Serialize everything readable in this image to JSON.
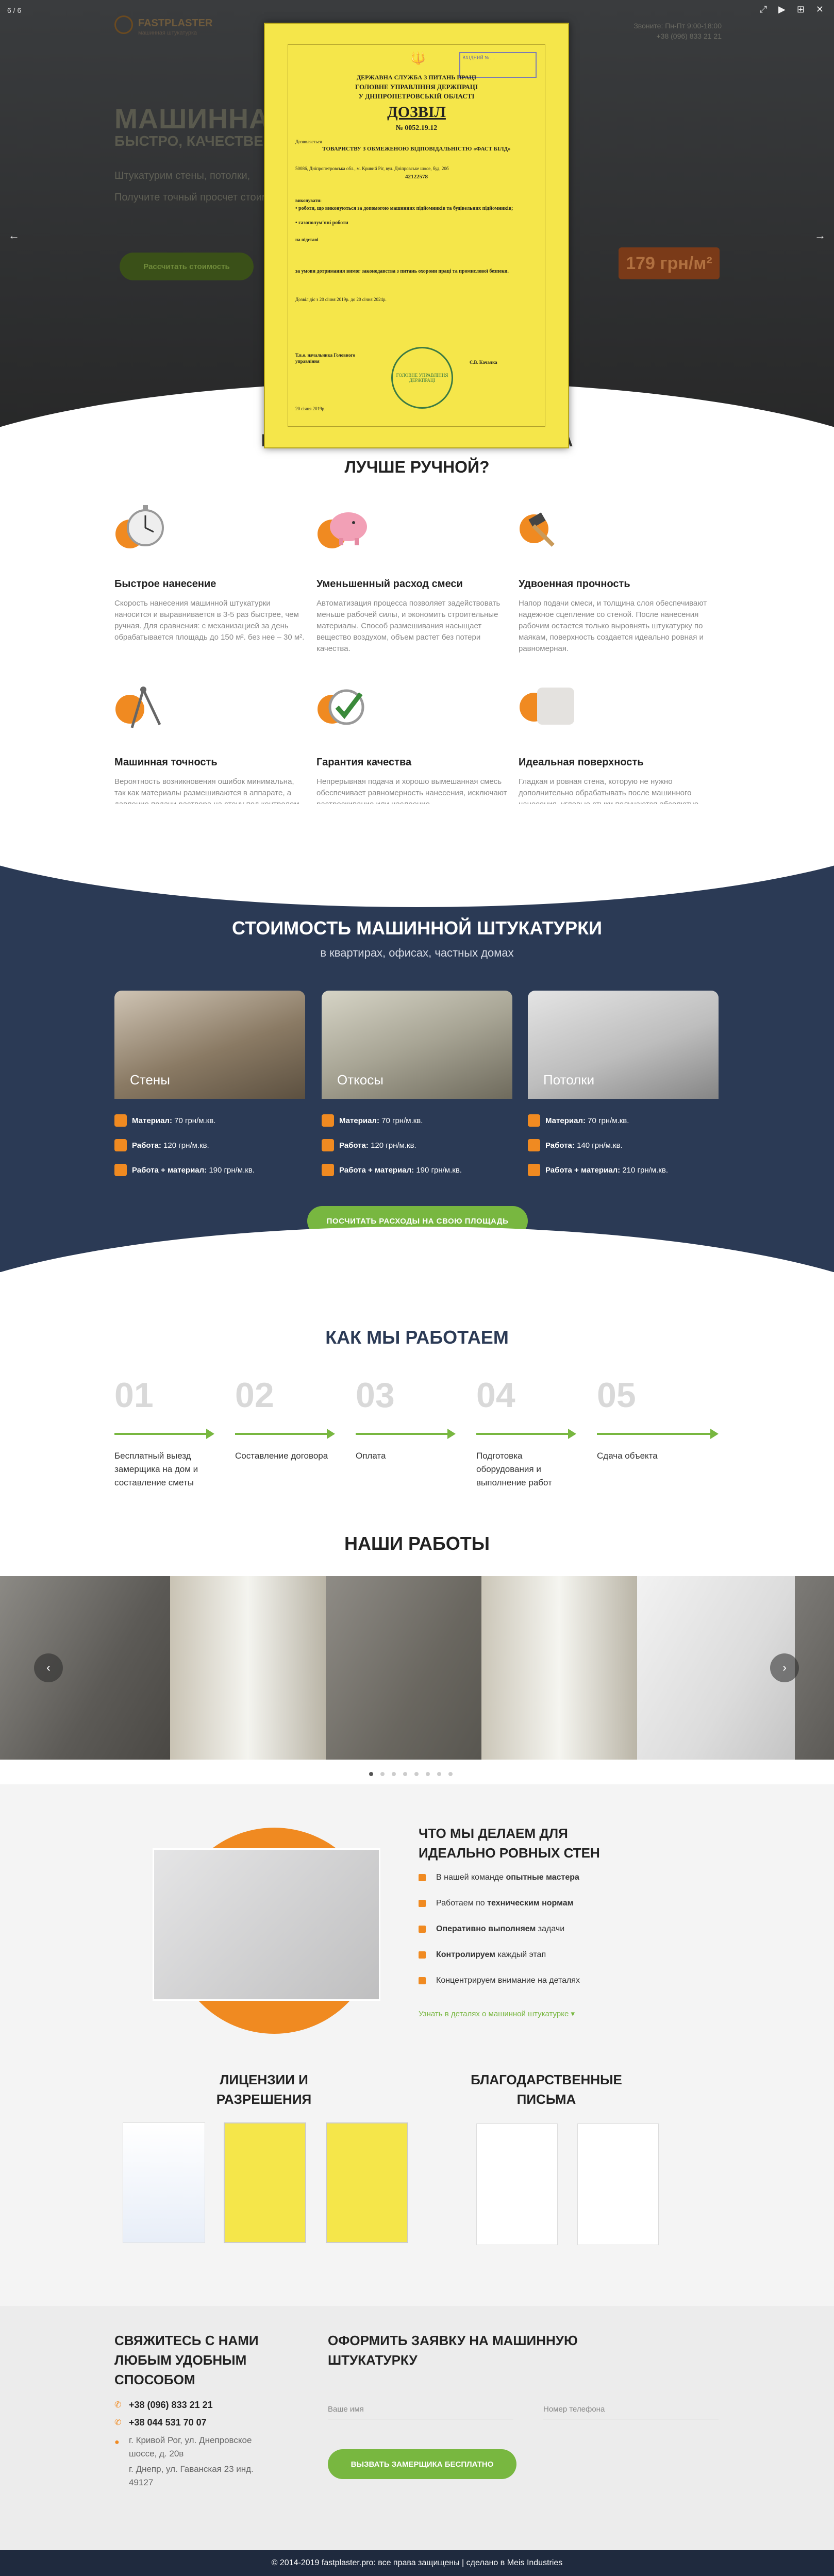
{
  "lightbox": {
    "counter": "6 / 6",
    "prev": "←",
    "next": "→",
    "tools": [
      "⤢",
      "▶",
      "⊞",
      "✕"
    ]
  },
  "hero": {
    "logo_title": "FASTPLASTER",
    "logo_sub": "машинная штукатурка",
    "contact_line1": "Звоните: Пн-Пт 9:00-18:00",
    "contact_line2": "+38 (096) 833 21 21",
    "h1": "МАШИННАЯ",
    "h2": "БЫСТРО, КАЧЕСТВЕННО",
    "p1": "Штукатурим стены, потолки,",
    "p2": "Получите точный просчет стоимости",
    "btn": "Рассчитать стоимость",
    "price": "179 грн/м²",
    "ghost_heading": "ПОЧЕМУ МАШИННАЯ ШТУКАТУРКА"
  },
  "license": {
    "stamp": "ВХІДНИЙ № ....",
    "l1": "ДЕРЖАВНА СЛУЖБА З ПИТАНЬ ПРАЦІ",
    "l2": "ГОЛОВНЕ УПРАВЛІННЯ ДЕРЖПРАЦІ",
    "l3": "У ДНІПРОПЕТРОВСЬКІЙ ОБЛАСТІ",
    "doc": "ДОЗВІЛ",
    "num": "№ 0052.19.12",
    "allowed": "Дозволяється",
    "company": "ТОВАРИСТВУ З ОБМЕЖЕНОЮ ВІДПОВІДАЛЬНІСТЮ «ФАСТ БІЛД»",
    "addr": "50086, Дніпропетровська обл., м. Кривий Ріг, вул. Дніпровське шосе, буд. 20б",
    "code": "42122578",
    "perform": "виконувати:",
    "w1": "• роботи, що виконуються за допомогою машинних підйомників та будівельних підйомників;",
    "w2": "• газополум'яні роботи",
    "basis": "на підставі",
    "cond": "за умови дотримання вимог законодавства з питань охорони праці та промислової безпеки.",
    "valid": "Дозвіл діє з 20 січня 2019р. до 20 січня 2024р.",
    "sign_role": "Т.в.о. начальника Головного управління",
    "sign_name": "Є.В. Качалка",
    "date": "20 січня 2019р.",
    "seal": "ГОЛОВНЕ УПРАВЛІННЯ ДЕРЖПРАЦІ"
  },
  "features": {
    "title": "ЛУЧШЕ РУЧНОЙ?",
    "items": [
      {
        "h": "Быстрое нанесение",
        "p": "Скорость нанесения машинной штукатурки наносится и выравнивается в 3-5 раз быстрее, чем ручная. Для сравнения: с механизацией за день обрабатывается площадь до 150 м². без нее – 30 м²."
      },
      {
        "h": "Уменьшенный расход смеси",
        "p": "Автоматизация процесса позволяет задействовать меньше рабочей силы, и экономить строительные материалы. Способ размешивания насыщает вещество воздухом, объем растет без потери качества."
      },
      {
        "h": "Удвоенная прочность",
        "p": "Напор подачи смеси, и толщина слоя обеспечивают надежное сцепление со стеной. После нанесения рабочим остается только выровнять штукатурку по маякам, поверхность создается идеально ровная и равномерная."
      },
      {
        "h": "Машинная точность",
        "p": "Вероятность возникновения ошибок минимальна, так как материалы размешиваются в аппарате, а давление подачи раствора на стену под контролем."
      },
      {
        "h": "Гарантия качества",
        "p": "Непрерывная подача и хорошо вымешанная смесь обеспечивает равномерность нанесения, исключают растрескивание или наслоение."
      },
      {
        "h": "Идеальная поверхность",
        "p": "Гладкая и ровная стена, которую не нужно дополнительно обрабатывать после машинного нанесения, углевые стыки получаются абсолютно ровные."
      }
    ]
  },
  "pricing": {
    "title": "СТОИМОСТЬ МАШИННОЙ ШТУКАТУРКИ",
    "sub": "в квартирах, офисах, частных домах",
    "cards": [
      {
        "label": "Стены",
        "material_k": "Материал:",
        "material_v": "70 грн/м.кв.",
        "work_k": "Работа:",
        "work_v": "120 грн/м.кв.",
        "both_k": "Работа + материал:",
        "both_v": "190 грн/м.кв."
      },
      {
        "label": "Откосы",
        "material_k": "Материал:",
        "material_v": "70 грн/м.кв.",
        "work_k": "Работа:",
        "work_v": "120 грн/м.кв.",
        "both_k": "Работа + материал:",
        "both_v": "190 грн/м.кв."
      },
      {
        "label": "Потолки",
        "material_k": "Материал:",
        "material_v": "70 грн/м.кв.",
        "work_k": "Работа:",
        "work_v": "140 грн/м.кв.",
        "both_k": "Работа + материал:",
        "both_v": "210 грн/м.кв."
      }
    ],
    "btn": "ПОСЧИТАТЬ РАСХОДЫ НА СВОЮ ПЛОЩАДЬ"
  },
  "how": {
    "title": "КАК МЫ РАБОТАЕМ",
    "steps": [
      {
        "num": "01",
        "txt": "Бесплатный выезд замерщика на дом и составление сметы"
      },
      {
        "num": "02",
        "txt": "Составление договора"
      },
      {
        "num": "03",
        "txt": "Оплата"
      },
      {
        "num": "04",
        "txt": "Подготовка оборудования и выполнение работ"
      },
      {
        "num": "05",
        "txt": "Сдача объекта"
      }
    ]
  },
  "works": {
    "title": "НАШИ РАБОТЫ",
    "prev": "‹",
    "next": "›",
    "active_dot": 1
  },
  "ideal": {
    "title": "ЧТО МЫ ДЕЛАЕМ ДЛЯ ИДЕАЛЬНО РОВНЫХ СТЕН",
    "items": [
      {
        "pre": "В нашей команде ",
        "b": "опытные мастера",
        "post": ""
      },
      {
        "pre": "Работаем по ",
        "b": "техническим нормам",
        "post": ""
      },
      {
        "pre": "",
        "b": "Оперативно выполняем",
        "post": " задачи"
      },
      {
        "pre": "",
        "b": "Контролируем",
        "post": " каждый этап"
      },
      {
        "pre": "Концентрируем внимание на деталях",
        "b": "",
        "post": ""
      }
    ],
    "link": "Узнать в деталях о машинной штукатурке"
  },
  "docs": {
    "licenses_title": "ЛИЦЕНЗИИ И РАЗРЕШЕНИЯ",
    "letters_title": "БЛАГОДАРСТВЕННЫЕ ПИСЬМА"
  },
  "footer": {
    "contact_title": "СВЯЖИТЕСЬ С НАМИ ЛЮБЫМ УДОБНЫМ СПОСОБОМ",
    "phone1": "+38 (096) 833 21 21",
    "phone2": "+38 044 531 70 07",
    "addr1": "г. Кривой Рог, ул. Днепровское шоссе, д. 20в",
    "addr2": "г. Днепр, ул. Гаванская 23 инд. 49127",
    "form_title": "ОФОРМИТЬ ЗАЯВКУ НА МАШИННУЮ ШТУКАТУРКУ",
    "name_ph": "Ваше имя",
    "phone_ph": "Номер телефона",
    "btn": "ВЫЗВАТЬ ЗАМЕРЩИКА БЕСПЛАТНО",
    "copyright": "© 2014-2019 fastplaster.pro: все права защищены | сделано в Meis Industries"
  },
  "colors": {
    "accent_orange": "#f08a21",
    "accent_green": "#78b740",
    "navy": "#2b3a55"
  }
}
